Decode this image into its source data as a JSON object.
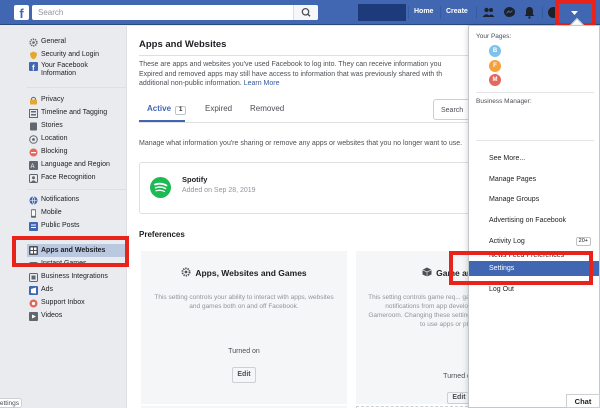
{
  "topbar": {
    "logo": "f",
    "search_placeholder": "Search",
    "home_label": "Home",
    "create_label": "Create",
    "icons": [
      "friend-requests-icon",
      "messenger-icon",
      "notifications-icon",
      "help-icon",
      "account-menu-icon"
    ]
  },
  "sidebar": {
    "items": [
      {
        "label": "General",
        "icon": "gear-icon"
      },
      {
        "label": "Security and Login",
        "icon": "shield-icon"
      },
      {
        "label": "Your Facebook",
        "label2": "Information",
        "icon": "facebook-icon"
      },
      {
        "label": "Privacy",
        "icon": "lock-icon"
      },
      {
        "label": "Timeline and Tagging",
        "icon": "timeline-icon"
      },
      {
        "label": "Stories",
        "icon": "stories-icon"
      },
      {
        "label": "Location",
        "icon": "location-icon"
      },
      {
        "label": "Blocking",
        "icon": "blocking-icon"
      },
      {
        "label": "Language and Region",
        "icon": "language-icon"
      },
      {
        "label": "Face Recognition",
        "icon": "face-icon"
      },
      {
        "label": "Notifications",
        "icon": "globe-icon"
      },
      {
        "label": "Mobile",
        "icon": "mobile-icon"
      },
      {
        "label": "Public Posts",
        "icon": "public-posts-icon"
      },
      {
        "label": "Apps and Websites",
        "icon": "apps-icon"
      },
      {
        "label": "Instant Games",
        "icon": "games-icon"
      },
      {
        "label": "Business Integrations",
        "icon": "business-icon"
      },
      {
        "label": "Ads",
        "icon": "ads-icon"
      },
      {
        "label": "Support Inbox",
        "icon": "support-icon"
      },
      {
        "label": "Videos",
        "icon": "video-icon"
      }
    ]
  },
  "main": {
    "title": "Apps and Websites",
    "intro": "These are apps and websites you've used Facebook to log into. They can receive information you",
    "intro2": "Expired and removed apps may still have access to information that was previously shared with th",
    "intro3": "additional non-public information.",
    "learn_more": "Learn More",
    "tabs": [
      {
        "label": "Active",
        "count": "1"
      },
      {
        "label": "Expired"
      },
      {
        "label": "Removed"
      }
    ],
    "search_apps_label": "Search",
    "manage_text": "Manage what information you're sharing or remove any apps or websites that you no longer want to use.",
    "app": {
      "name": "Spotify",
      "added": "Added on Sep 28, 2019",
      "view_label": "V"
    },
    "preferences_title": "Preferences",
    "cards": [
      {
        "title": "Apps, Websites and Games",
        "desc": "This setting controls your ability to interact with apps, websites and games both on and off Facebook.",
        "status": "Turned on",
        "button": "Edit"
      },
      {
        "title": "Game and App",
        "desc": "This setting controls game req... game status updates, and app notifications from app developers on Facebook and Gameroom. Changing these settings will not impact your ability to use apps or play games.",
        "status": "Turned on",
        "button": "Edit"
      }
    ]
  },
  "dropdown": {
    "your_pages_label": "Your Pages:",
    "pages": [
      {
        "initial": "B",
        "color": "#7fc1ea"
      },
      {
        "initial": "F",
        "color": "#f5a13c"
      },
      {
        "initial": "M",
        "color": "#e2675d"
      }
    ],
    "business_manager_label": "Business Manager:",
    "items": [
      {
        "label": "See More..."
      },
      {
        "label": "Manage Pages"
      },
      {
        "label": "Manage Groups"
      },
      {
        "label": "Advertising on Facebook"
      },
      {
        "label": "Activity Log",
        "badge": "20+"
      },
      {
        "label": "News Feed Preferences"
      },
      {
        "label": "Settings"
      },
      {
        "label": "Log Out"
      }
    ]
  },
  "chat_label": "Chat",
  "settings_tab_label": "ettings",
  "colors": {
    "brand": "#4267b2",
    "highlight": "#e8231b",
    "spotify": "#1db954"
  }
}
